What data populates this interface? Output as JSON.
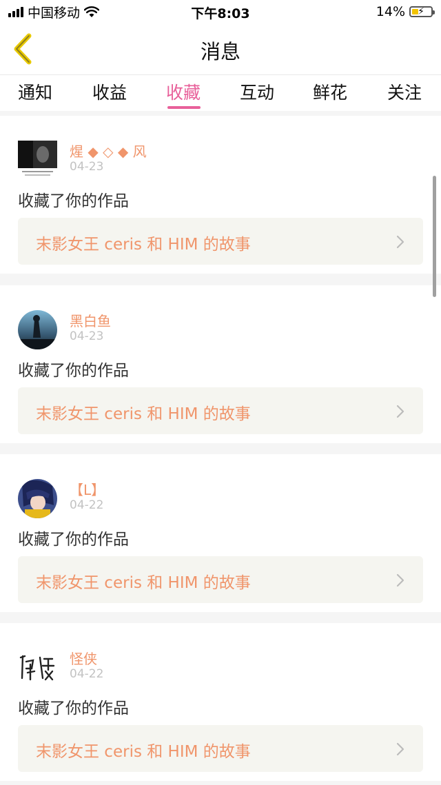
{
  "status_bar": {
    "carrier": "中国移动",
    "time": "下午8:03",
    "battery": "14%",
    "battery_level": 0.14
  },
  "nav": {
    "title": "消息",
    "back_icon": "chevron-left-icon"
  },
  "tabs": [
    {
      "label": "通知"
    },
    {
      "label": "收益"
    },
    {
      "label": "收藏"
    },
    {
      "label": "互动"
    },
    {
      "label": "鲜花"
    },
    {
      "label": "关注"
    }
  ],
  "active_tab": "收藏",
  "colors": {
    "accent": "#e8609a",
    "username": "#f0956b",
    "back_icon": "#e8c900"
  },
  "feed": [
    {
      "username": "煋 ◆ ◇ ◆ 风",
      "date": "04-23",
      "action": "收藏了你的作品",
      "work_title": "末影女王 ceris 和 HIM 的故事"
    },
    {
      "username": "黑白鱼",
      "date": "04-23",
      "action": "收藏了你的作品",
      "work_title": "末影女王 ceris 和 HIM 的故事"
    },
    {
      "username": "【L】",
      "date": "04-22",
      "action": "收藏了你的作品",
      "work_title": "末影女王 ceris 和 HIM 的故事"
    },
    {
      "username": "怪侠",
      "date": "04-22",
      "action": "收藏了你的作品",
      "work_title": "末影女王 ceris 和 HIM 的故事"
    }
  ]
}
